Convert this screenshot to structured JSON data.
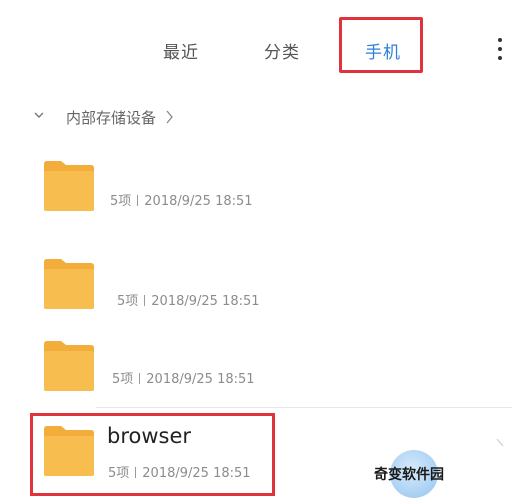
{
  "tabs": {
    "recent": "最近",
    "category": "分类",
    "phone": "手机"
  },
  "breadcrumb": {
    "label": "内部存储设备"
  },
  "folders": [
    {
      "name": "",
      "count": "5项",
      "date": "2018/9/25 18:51"
    },
    {
      "name": "",
      "count": "5项",
      "date": "2018/9/25 18:51"
    },
    {
      "name": "",
      "count": "5项",
      "date": "2018/9/25 18:51"
    },
    {
      "name": "browser",
      "count": "5项",
      "date": "2018/9/25 18:51"
    }
  ],
  "watermark": {
    "text": "奇变软件园"
  },
  "icons": {
    "more": "more-vertical-icon",
    "expand": "chevron-down-icon",
    "path": "chevron-right-icon",
    "folder": "folder-icon"
  },
  "colors": {
    "active_tab": "#2f7fd8",
    "highlight": "#e0333c",
    "folder": "#f6b94a"
  }
}
